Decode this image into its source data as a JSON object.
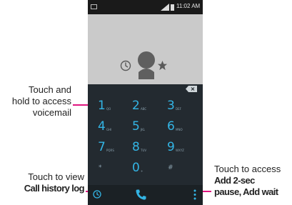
{
  "callouts": {
    "voicemail": [
      "Touch and",
      "hold to access",
      "voicemail"
    ],
    "history": {
      "line1": "Touch to view",
      "line2": "Call history log"
    },
    "more": {
      "line1": "Touch to access",
      "line2": "Add 2-sec",
      "line3": "pause, Add wait"
    }
  },
  "statusbar": {
    "time": "11:02 AM"
  },
  "keypad": [
    [
      {
        "digit": "1",
        "letters": "QO"
      },
      {
        "digit": "2",
        "letters": "ABC"
      },
      {
        "digit": "3",
        "letters": "DEF"
      }
    ],
    [
      {
        "digit": "4",
        "letters": "GHI"
      },
      {
        "digit": "5",
        "letters": "JKL"
      },
      {
        "digit": "6",
        "letters": "MNO"
      }
    ],
    [
      {
        "digit": "7",
        "letters": "PQRS"
      },
      {
        "digit": "8",
        "letters": "TUV"
      },
      {
        "digit": "9",
        "letters": "WXYZ"
      }
    ],
    [
      {
        "digit": "*",
        "letters": ""
      },
      {
        "digit": "0",
        "letters": "+"
      },
      {
        "digit": "#",
        "letters": ""
      }
    ]
  ],
  "colors": {
    "accent": "#33b5e5",
    "callout_line": "#e0157f",
    "dialpad_bg": "#232a30"
  },
  "icons": [
    "recents-icon",
    "avatar",
    "star-icon",
    "backspace-icon",
    "call-history-icon",
    "phone-call-icon",
    "more-icon"
  ]
}
